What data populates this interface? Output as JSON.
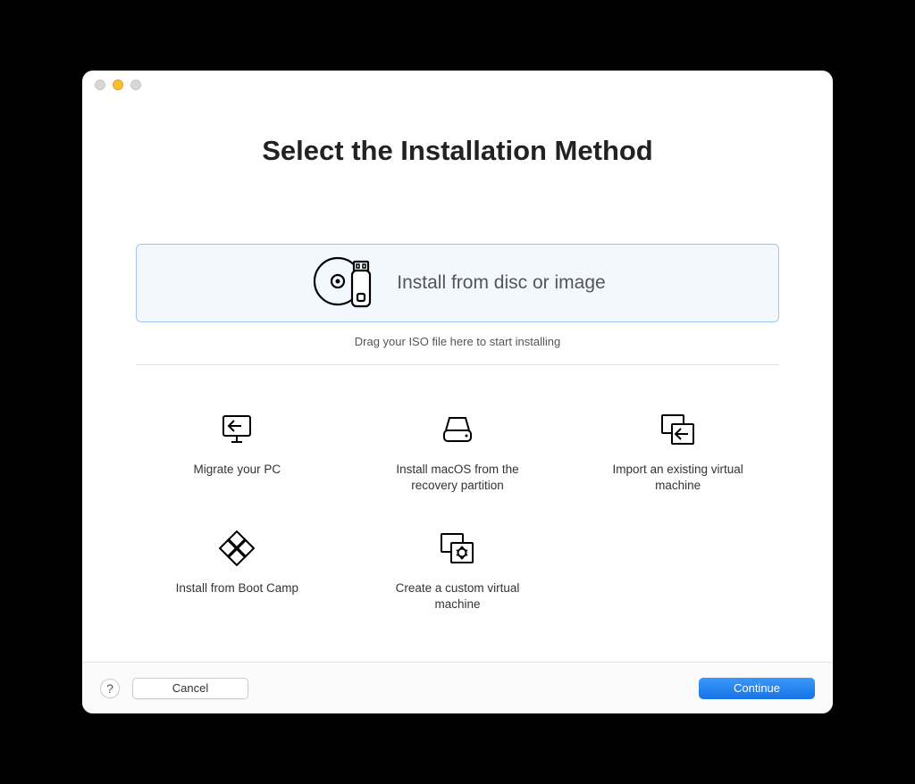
{
  "title": "Select the Installation Method",
  "primary_option": {
    "label": "Install from disc or image",
    "hint": "Drag your ISO file here to start installing"
  },
  "options": {
    "migrate_pc": "Migrate your PC",
    "install_macos": "Install macOS from the recovery partition",
    "import_vm": "Import an existing virtual machine",
    "boot_camp": "Install from Boot Camp",
    "custom_vm": "Create a custom virtual machine"
  },
  "footer": {
    "help": "?",
    "cancel": "Cancel",
    "continue": "Continue"
  }
}
